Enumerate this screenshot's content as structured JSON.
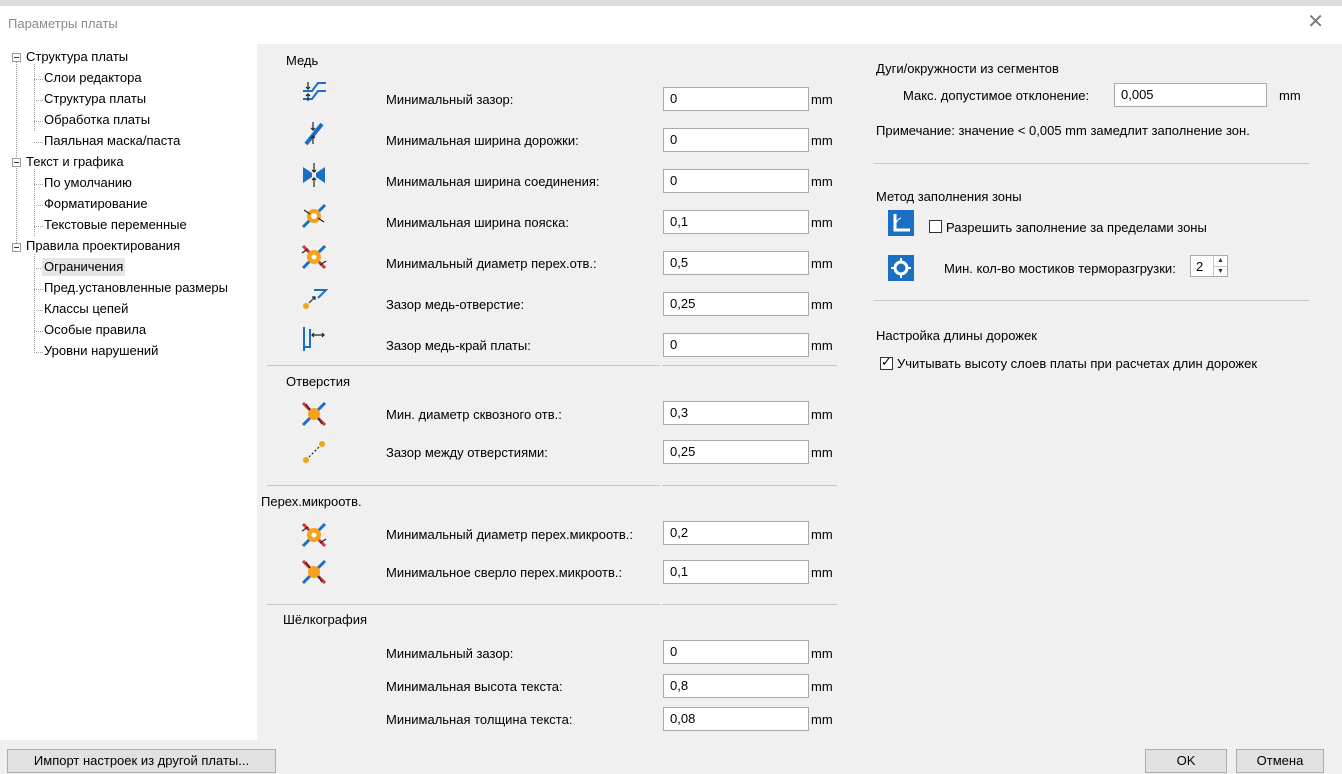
{
  "window": {
    "title": "Параметры платы"
  },
  "tree": {
    "items": [
      "Структура платы",
      "Слои редактора",
      "Структура платы",
      "Обработка платы",
      "Паяльная маска/паста",
      "Текст и графика",
      "По умолчанию",
      "Форматирование",
      "Текстовые переменные",
      "Правила проектирования",
      "Ограничения",
      "Пред.установленные размеры",
      "Классы цепей",
      "Особые правила",
      "Уровни нарушений"
    ]
  },
  "copper": {
    "heading": "Медь",
    "rows": [
      {
        "label": "Минимальный зазор:",
        "value": "0",
        "unit": "mm"
      },
      {
        "label": "Минимальная ширина дорожки:",
        "value": "0",
        "unit": "mm"
      },
      {
        "label": "Минимальная ширина соединения:",
        "value": "0",
        "unit": "mm"
      },
      {
        "label": "Минимальная ширина пояска:",
        "value": "0,1",
        "unit": "mm"
      },
      {
        "label": "Минимальный диаметр перех.отв.:",
        "value": "0,5",
        "unit": "mm"
      },
      {
        "label": "Зазор медь-отверстие:",
        "value": "0,25",
        "unit": "mm"
      },
      {
        "label": "Зазор медь-край платы:",
        "value": "0",
        "unit": "mm"
      }
    ]
  },
  "holes": {
    "heading": "Отверстия",
    "rows": [
      {
        "label": "Мин. диаметр сквозного отв.:",
        "value": "0,3",
        "unit": "mm"
      },
      {
        "label": "Зазор между отверстиями:",
        "value": "0,25",
        "unit": "mm"
      }
    ]
  },
  "microvias": {
    "heading": "Перех.микроотв.",
    "rows": [
      {
        "label": "Минимальный диаметр перех.микроотв.:",
        "value": "0,2",
        "unit": "mm"
      },
      {
        "label": "Минимальное сверло перех.микроотв.:",
        "value": "0,1",
        "unit": "mm"
      }
    ]
  },
  "silk": {
    "heading": "Шёлкография",
    "rows": [
      {
        "label": "Минимальный зазор:",
        "value": "0",
        "unit": "mm"
      },
      {
        "label": "Минимальная высота текста:",
        "value": "0,8",
        "unit": "mm"
      },
      {
        "label": "Минимальная толщина текста:",
        "value": "0,08",
        "unit": "mm"
      }
    ]
  },
  "arcs": {
    "heading": "Дуги/окружности из сегментов",
    "max_label": "Макс. допустимое отклонение:",
    "max_value": "0,005",
    "unit": "mm",
    "note": "Примечание: значение < 0,005 mm замедлит заполнение зон."
  },
  "zonefill": {
    "heading": "Метод заполнения зоны",
    "allow_label": "Разрешить заполнение за пределами зоны",
    "allow_checked": false,
    "spokes_label": "Мин. кол-во мостиков терморазгрузки:",
    "spokes_value": "2"
  },
  "tracklen": {
    "heading": "Настройка длины дорожек",
    "stackup_label": "Учитывать высоту слоев платы при расчетах длин дорожек",
    "stackup_checked": true
  },
  "footer": {
    "import_label": "Импорт настроек из другой платы...",
    "ok_label": "OK",
    "cancel_label": "Отмена"
  },
  "colors": {
    "icon_blue": "#1a6fc4",
    "icon_orange": "#f5a11c",
    "icon_red": "#d6303a"
  }
}
